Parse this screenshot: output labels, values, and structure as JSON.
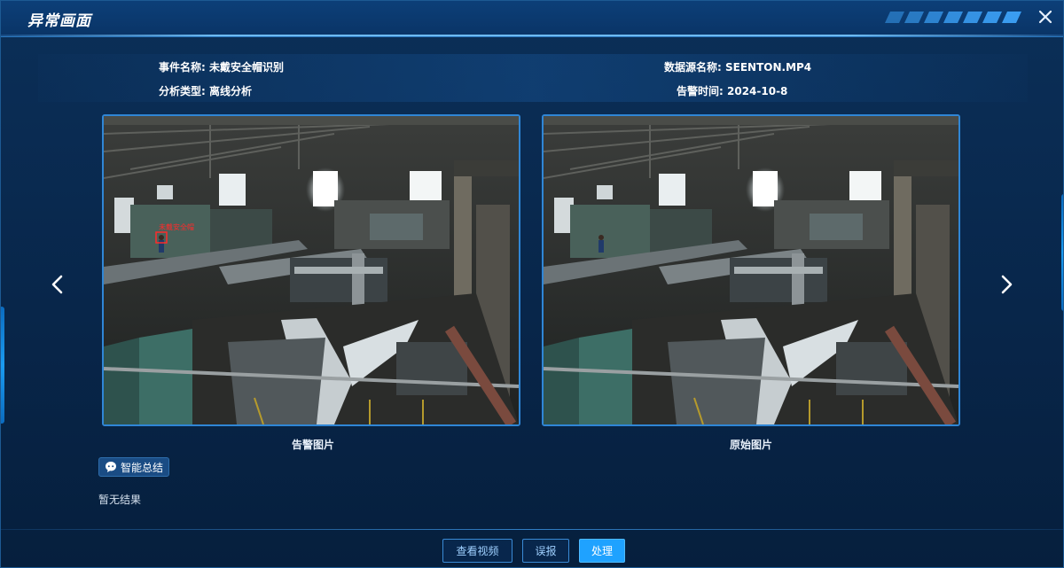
{
  "dialog": {
    "title": "异常画面",
    "close_icon": "close-icon"
  },
  "info": {
    "event_name_label": "事件名称:",
    "event_name_value": "未戴安全帽识别",
    "analysis_type_label": "分析类型:",
    "analysis_type_value": "离线分析",
    "source_name_label": "数据源名称:",
    "source_name_value": "SEENTON.MP4",
    "alarm_time_label": "告警时间:",
    "alarm_time_value": "2024-10-8"
  },
  "images": {
    "alarm_caption": "告警图片",
    "original_caption": "原始图片",
    "detection_label": "未戴安全帽"
  },
  "nav": {
    "prev_icon": "chevron-left-icon",
    "next_icon": "chevron-right-icon"
  },
  "summary": {
    "button_label": "智能总结",
    "icon": "robot-chat-icon",
    "result_text": "暂无结果"
  },
  "footer": {
    "view_video_label": "查看视频",
    "false_report_label": "误报",
    "handle_label": "处理"
  },
  "colors": {
    "accent": "#1fa2ff",
    "frame_border": "#2f86d6",
    "detection_box": "#ff2a2a",
    "background": "#08264a"
  }
}
